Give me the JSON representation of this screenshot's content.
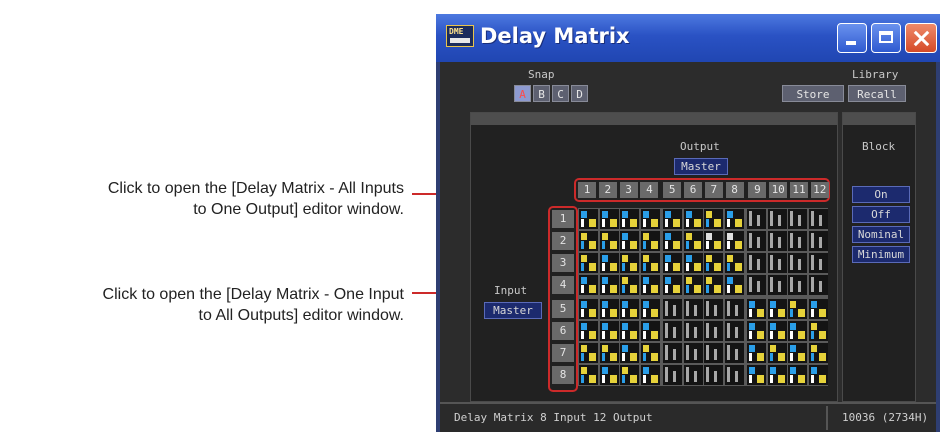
{
  "annotations": {
    "c1_line1": "Click to open the [Delay Matrix - All Inputs",
    "c1_line2": "to One Output] editor window.",
    "c2_line1": "Click to open the [Delay Matrix - One Input",
    "c2_line2": "to All Outputs] editor window.",
    "line_color": "#cc2a2a"
  },
  "window": {
    "icon_text": "DME",
    "title": "Delay Matrix",
    "controls": [
      "minimize",
      "maximize",
      "close"
    ]
  },
  "snap": {
    "label": "Snap",
    "buttons": [
      "A",
      "B",
      "C",
      "D"
    ],
    "selected": "A"
  },
  "library": {
    "label": "Library",
    "store": "Store",
    "recall": "Recall"
  },
  "output": {
    "label": "Output",
    "master": "Master"
  },
  "input": {
    "label": "Input",
    "master": "Master"
  },
  "output_numbers": [
    "1",
    "2",
    "3",
    "4",
    "5",
    "6",
    "7",
    "8",
    "9",
    "10",
    "11",
    "12"
  ],
  "input_numbers": [
    "1",
    "2",
    "3",
    "4",
    "5",
    "6",
    "7",
    "8"
  ],
  "block": {
    "label": "Block",
    "buttons": [
      "On",
      "Off",
      "Nominal",
      "Minimum"
    ]
  },
  "matrix_legend": {
    "blue": "#2a9ee8",
    "yellow": "#e6d23a",
    "gray": "#a8a8a8"
  },
  "matrix": [
    [
      "B",
      "B",
      "B",
      "B",
      "B",
      "B",
      "Y",
      "B",
      "G",
      "G",
      "G",
      "G"
    ],
    [
      "Y",
      "Y",
      "B",
      "Y",
      "B",
      "Y",
      "W",
      "W",
      "G",
      "G",
      "G",
      "G"
    ],
    [
      "Y",
      "B",
      "Y",
      "Y",
      "B",
      "B",
      "Y",
      "Y",
      "G",
      "G",
      "G",
      "G"
    ],
    [
      "B",
      "B",
      "Y",
      "B",
      "B",
      "Y",
      "Y",
      "B",
      "G",
      "G",
      "G",
      "G"
    ],
    [
      "B",
      "B",
      "B",
      "B",
      "G",
      "G",
      "G",
      "G",
      "B",
      "B",
      "Y",
      "B"
    ],
    [
      "B",
      "B",
      "B",
      "B",
      "G",
      "G",
      "G",
      "G",
      "B",
      "B",
      "B",
      "Y"
    ],
    [
      "Y",
      "Y",
      "B",
      "Y",
      "G",
      "G",
      "G",
      "G",
      "B",
      "Y",
      "B",
      "Y"
    ],
    [
      "Y",
      "B",
      "Y",
      "B",
      "G",
      "G",
      "G",
      "G",
      "B",
      "B",
      "B",
      "B"
    ]
  ],
  "status": {
    "left": "Delay Matrix  8 Input 12 Output",
    "right": "10036 (2734H)"
  }
}
